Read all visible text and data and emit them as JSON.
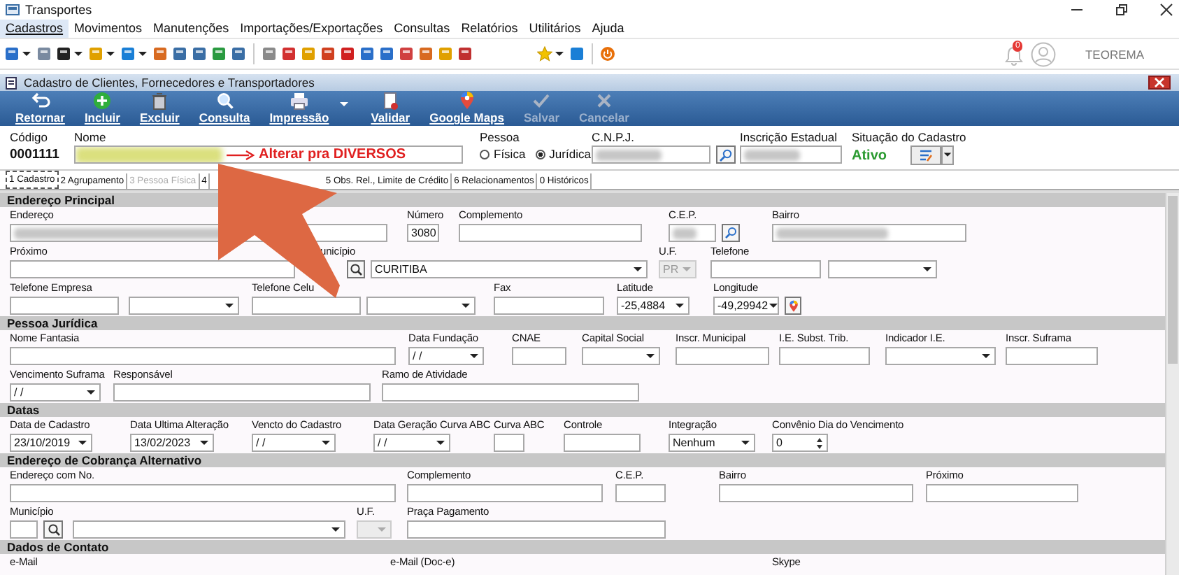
{
  "window": {
    "title": "Transportes"
  },
  "menu": [
    {
      "label": "Cadastros",
      "selected": true
    },
    {
      "label": "Movimentos",
      "selected": false
    },
    {
      "label": "Manutenções",
      "selected": false
    },
    {
      "label": "Importações/Exportações",
      "selected": false
    },
    {
      "label": "Consultas",
      "selected": false
    },
    {
      "label": "Relatórios",
      "selected": false
    },
    {
      "label": "Utilitários",
      "selected": false
    },
    {
      "label": "Ajuda",
      "selected": false
    }
  ],
  "user": {
    "notifications": "0",
    "name": "TEOREMA"
  },
  "form": {
    "title": "Cadastro de Clientes, Fornecedores e Transportadores",
    "actions": [
      {
        "kind": "return",
        "label": "Retornar",
        "disabled": false,
        "dropdown": false
      },
      {
        "kind": "add",
        "label": "Incluir",
        "disabled": false,
        "dropdown": false
      },
      {
        "kind": "delete",
        "label": "Excluir",
        "disabled": false,
        "dropdown": false
      },
      {
        "kind": "search",
        "label": "Consulta",
        "disabled": false,
        "dropdown": false
      },
      {
        "kind": "print",
        "label": "Impressão",
        "disabled": false,
        "dropdown": true
      },
      {
        "kind": "validate",
        "label": "Validar",
        "disabled": false,
        "dropdown": false
      },
      {
        "kind": "map",
        "label": "Google Maps",
        "disabled": false,
        "dropdown": false
      },
      {
        "kind": "save",
        "label": "Salvar",
        "disabled": true,
        "dropdown": false
      },
      {
        "kind": "cancel",
        "label": "Cancelar",
        "disabled": true,
        "dropdown": false
      }
    ],
    "header": {
      "code_label": "Código",
      "code": "0001111",
      "name_label": "Nome",
      "name_note": "Alterar pra DIVERSOS",
      "person_label": "Pessoa",
      "person_options": [
        {
          "label": "Física",
          "selected": false
        },
        {
          "label": "Jurídica",
          "selected": true
        }
      ],
      "cnpj_label": "C.N.P.J.",
      "ie_label": "Inscrição Estadual",
      "status_label": "Situação do Cadastro",
      "status": "Ativo"
    },
    "tabs": [
      {
        "label": "1 Cadastro",
        "selected": true,
        "disabled": false
      },
      {
        "label": "2 Agrupamento",
        "selected": false,
        "disabled": false
      },
      {
        "label": "3 Pessoa Física",
        "selected": false,
        "disabled": true
      },
      {
        "label": "4",
        "selected": false,
        "disabled": false
      },
      {
        "label": "5 Obs. Rel., Limite de Crédito",
        "selected": false,
        "disabled": false
      },
      {
        "label": "6 Relacionamentos",
        "selected": false,
        "disabled": false
      },
      {
        "label": "0 Históricos",
        "selected": false,
        "disabled": false
      }
    ],
    "sections": [
      {
        "title": "Endereço Principal",
        "rows": [
          {
            "fields": [
              {
                "label": "Endereço",
                "controls": [
                  {
                    "kind": "blurred"
                  }
                ]
              },
              {
                "label": "Número",
                "controls": [
                  {
                    "kind": "input",
                    "value": "3080"
                  }
                ]
              },
              {
                "label": "Complemento",
                "controls": [
                  {
                    "kind": "input"
                  }
                ]
              },
              {
                "label": "C.E.P.",
                "controls": [
                  {
                    "kind": "blurred"
                  },
                  {
                    "kind": "lookup"
                  }
                ]
              },
              {
                "label": "Bairro",
                "controls": [
                  {
                    "kind": "blurred"
                  }
                ]
              }
            ]
          },
          {
            "fields": [
              {
                "label": "Próximo",
                "controls": [
                  {
                    "kind": "input"
                  }
                ]
              },
              {
                "label": "unicípio",
                "controls": [
                  {
                    "kind": "search"
                  },
                  {
                    "kind": "select",
                    "value": "CURITIBA"
                  }
                ]
              },
              {
                "label": "U.F.",
                "controls": [
                  {
                    "kind": "select",
                    "value": "PR",
                    "disabled": true
                  }
                ]
              },
              {
                "label": "Telefone",
                "controls": [
                  {
                    "kind": "input"
                  }
                ]
              },
              {
                "controls": [
                  {
                    "kind": "select"
                  }
                ]
              }
            ]
          },
          {
            "fields": [
              {
                "label": "Telefone Empresa",
                "controls": [
                  {
                    "kind": "input"
                  }
                ]
              },
              {
                "controls": [
                  {
                    "kind": "select"
                  }
                ]
              },
              {
                "label": "Telefone Celu",
                "controls": [
                  {
                    "kind": "input"
                  }
                ]
              },
              {
                "controls": [
                  {
                    "kind": "select"
                  }
                ]
              },
              {
                "label": "Fax",
                "controls": [
                  {
                    "kind": "input"
                  }
                ]
              },
              {
                "label": "Latitude",
                "controls": [
                  {
                    "kind": "select",
                    "value": "-25,4884"
                  }
                ]
              },
              {
                "label": "Longitude",
                "controls": [
                  {
                    "kind": "select",
                    "value": "-49,29942"
                  },
                  {
                    "kind": "map"
                  }
                ]
              }
            ]
          }
        ]
      },
      {
        "title": "Pessoa Jurídica",
        "rows": [
          {
            "fields": [
              {
                "label": "Nome Fantasia",
                "controls": [
                  {
                    "kind": "input"
                  }
                ]
              },
              {
                "label": "Data Fundação",
                "controls": [
                  {
                    "kind": "select",
                    "value": "/ /"
                  }
                ]
              },
              {
                "label": "CNAE",
                "controls": [
                  {
                    "kind": "input"
                  }
                ]
              },
              {
                "label": "Capital Social",
                "controls": [
                  {
                    "kind": "select"
                  }
                ]
              },
              {
                "label": "Inscr. Municipal",
                "controls": [
                  {
                    "kind": "input"
                  }
                ]
              },
              {
                "label": "I.E. Subst. Trib.",
                "controls": [
                  {
                    "kind": "input"
                  }
                ]
              },
              {
                "label": "Indicador I.E.",
                "controls": [
                  {
                    "kind": "select"
                  }
                ]
              },
              {
                "label": "Inscr. Suframa",
                "controls": [
                  {
                    "kind": "input"
                  }
                ]
              }
            ]
          },
          {
            "fields": [
              {
                "label": "Vencimento Suframa",
                "controls": [
                  {
                    "kind": "select",
                    "value": "/ /"
                  }
                ]
              },
              {
                "label": "Responsável",
                "controls": [
                  {
                    "kind": "input"
                  }
                ]
              },
              {
                "label": "Ramo de Atividade",
                "controls": [
                  {
                    "kind": "input"
                  }
                ]
              }
            ]
          }
        ]
      },
      {
        "title": "Datas",
        "rows": [
          {
            "fields": [
              {
                "label": "Data de Cadastro",
                "controls": [
                  {
                    "kind": "select",
                    "value": "23/10/2019"
                  }
                ]
              },
              {
                "label": "Data Ultima Alteração",
                "controls": [
                  {
                    "kind": "select",
                    "value": "13/02/2023"
                  }
                ]
              },
              {
                "label": "Vencto do Cadastro",
                "controls": [
                  {
                    "kind": "select",
                    "value": "/ /"
                  }
                ]
              },
              {
                "label": "Data Geração Curva ABC",
                "controls": [
                  {
                    "kind": "select",
                    "value": "/ /"
                  }
                ]
              },
              {
                "label": "Curva ABC",
                "controls": [
                  {
                    "kind": "input"
                  }
                ]
              },
              {
                "label": "Controle",
                "controls": [
                  {
                    "kind": "input"
                  }
                ]
              },
              {
                "label": "Integração",
                "controls": [
                  {
                    "kind": "select",
                    "value": "Nenhum"
                  }
                ]
              },
              {
                "label": "Convênio Dia do Vencimento",
                "controls": [
                  {
                    "kind": "spin",
                    "value": "0"
                  }
                ]
              }
            ]
          }
        ]
      },
      {
        "title": "Endereço de Cobrança Alternativo",
        "rows": [
          {
            "fields": [
              {
                "label": "Endereço com No.",
                "controls": [
                  {
                    "kind": "input"
                  }
                ]
              },
              {
                "label": "Complemento",
                "controls": [
                  {
                    "kind": "input"
                  }
                ]
              },
              {
                "label": "C.E.P.",
                "controls": [
                  {
                    "kind": "input"
                  }
                ]
              },
              {
                "label": "Bairro",
                "controls": [
                  {
                    "kind": "input"
                  }
                ]
              },
              {
                "label": "Próximo",
                "controls": [
                  {
                    "kind": "input"
                  }
                ]
              }
            ]
          },
          {
            "fields": [
              {
                "label": "Município",
                "controls": [
                  {
                    "kind": "input"
                  },
                  {
                    "kind": "search"
                  }
                ]
              },
              {
                "controls": [
                  {
                    "kind": "select"
                  }
                ]
              },
              {
                "label": "U.F.",
                "controls": [
                  {
                    "kind": "select",
                    "disabled": true
                  }
                ]
              },
              {
                "label": "Praça Pagamento",
                "controls": [
                  {
                    "kind": "input"
                  }
                ]
              }
            ]
          }
        ]
      },
      {
        "title": "Dados de Contato",
        "rows": [
          {
            "fields": [
              {
                "label": "e-Mail"
              },
              {
                "label": "e-Mail (Doc-e)"
              },
              {
                "label": "Skype"
              }
            ]
          }
        ]
      }
    ]
  }
}
